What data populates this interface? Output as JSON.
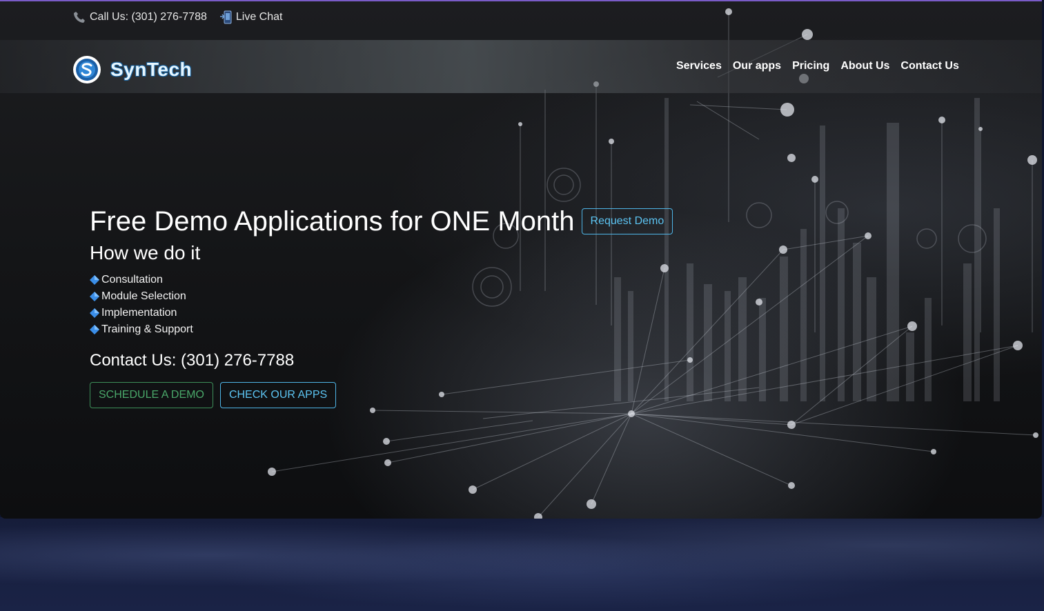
{
  "topbar": {
    "call_label": "Call Us: (301) 276-7788",
    "chat_label": "Live Chat"
  },
  "brand": {
    "name": "SynTech",
    "accent": "#4fb6e8"
  },
  "nav": {
    "items": [
      {
        "label": "Services"
      },
      {
        "label": "Our apps"
      },
      {
        "label": "Pricing"
      },
      {
        "label": "About Us"
      },
      {
        "label": "Contact Us"
      }
    ]
  },
  "hero": {
    "headline": "Free Demo Applications for ONE Month",
    "request_demo_label": "Request Demo",
    "subheading": "How we do it",
    "steps": [
      {
        "label": "Consultation"
      },
      {
        "label": "Module Selection"
      },
      {
        "label": "Implementation"
      },
      {
        "label": "Training & Support"
      }
    ],
    "contact": "Contact Us: (301) 276-7788",
    "schedule_label": "SCHEDULE A DEMO",
    "apps_label": "CHECK OUR APPS"
  }
}
